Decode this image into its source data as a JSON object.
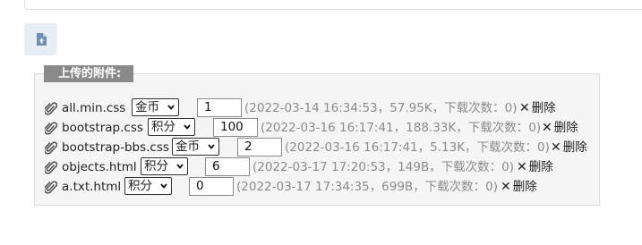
{
  "panel": {
    "title": "上传的附件:"
  },
  "attachments": [
    {
      "name": "all.min.css",
      "currency": "金币",
      "price": "1",
      "meta": "(2022-03-14 16:34:53，57.95K，下载次数：0)",
      "delete_label": "删除"
    },
    {
      "name": "bootstrap.css",
      "currency": "积分",
      "price": "100",
      "meta": "(2022-03-16 16:17:41，188.33K，下载次数：0)",
      "delete_label": "删除"
    },
    {
      "name": "bootstrap-bbs.css",
      "currency": "金币",
      "price": "2",
      "meta": "(2022-03-16 16:17:41，5.13K，下载次数：0)",
      "delete_label": "删除"
    },
    {
      "name": "objects.html",
      "currency": "积分",
      "price": "6",
      "meta": "(2022-03-17 17:20:53，149B，下载次数：0)",
      "delete_label": "删除"
    },
    {
      "name": "a.txt.html",
      "currency": "积分",
      "price": "0",
      "meta": "(2022-03-17 17:34:35，699B，下载次数：0)",
      "delete_label": "删除"
    }
  ],
  "icons": {
    "upload": "file-upload-icon",
    "attachment": "paperclip-icon",
    "delete": "close-icon"
  },
  "colors": {
    "title_bg": "#8a8a8a",
    "panel_bg": "#f5f5f5",
    "upload_bg": "#e8eef6",
    "meta_text": "#8c8c8c"
  }
}
